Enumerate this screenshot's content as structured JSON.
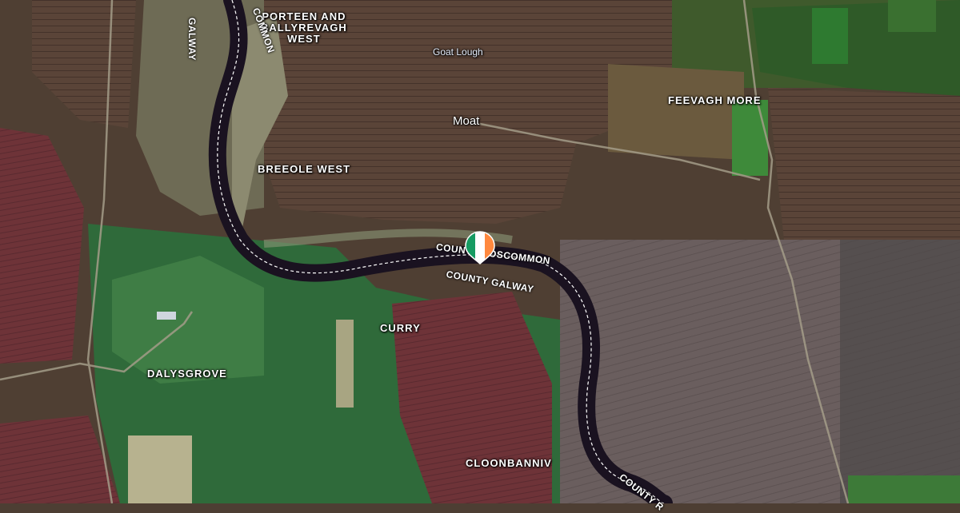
{
  "map": {
    "type": "satellite",
    "river_color": "#1a1220",
    "border_color": "#ffffff"
  },
  "places": {
    "porteen": [
      "PORTEEN AND",
      "BALLYREVAGH",
      "WEST"
    ],
    "goat_lough": "Goat Lough",
    "moat": "Moat",
    "feevagh_more": "FEEVAGH MORE",
    "breeole_west": "BREEOLE WEST",
    "curry": "CURRY",
    "dalysgrove": "DALYSGROVE",
    "cloonbanniv": "CLOONBANNIV"
  },
  "borders": {
    "top_left": "GALWAY",
    "top_left_2": "COMMON",
    "roscommon": "COUNTY ROSCOMMON",
    "galway": "COUNTY GALWAY",
    "bottom_right": "COUNTY R"
  },
  "marker": {
    "icon": "ireland-flag-pin-icon",
    "flag_colors": [
      "#169b62",
      "#ffffff",
      "#ff883e"
    ]
  }
}
